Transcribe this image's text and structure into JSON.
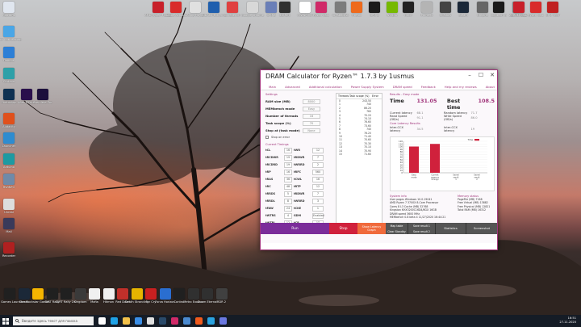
{
  "desktop": {
    "top_icons": [
      {
        "label": "AMD Ryzen Master",
        "color": "#c8202a"
      },
      {
        "label": "Adobe Acrobat",
        "color": "#d92b2b"
      },
      {
        "label": "Aimp Player",
        "color": "#e0e0e0"
      },
      {
        "label": "AIDA64 Extreme",
        "color": "#1f5fae"
      },
      {
        "label": "Cinebench",
        "color": "#e04040"
      },
      {
        "label": "Google Chrome",
        "color": "#d8d8d8"
      },
      {
        "label": "CPU-Z",
        "color": "#6a7fb8"
      },
      {
        "label": "3DMark",
        "color": "#303030"
      },
      {
        "label": "HWiNFO64",
        "color": "#ffffff"
      },
      {
        "label": "Ryzen Calc",
        "color": "#d02a68"
      },
      {
        "label": "CrystalDisk",
        "color": "#7c7c7c"
      },
      {
        "label": "Firefox",
        "color": "#ee6a1c"
      },
      {
        "label": "GPU-Z",
        "color": "#1a1a1a"
      },
      {
        "label": "NVIDIA",
        "color": "#76b900"
      },
      {
        "label": "OCCT",
        "color": "#222222"
      },
      {
        "label": "Prime95",
        "color": "#b4b4b4"
      },
      {
        "label": "Shadow",
        "color": "#444444"
      },
      {
        "label": "Steam",
        "color": "#1b2838"
      },
      {
        "label": "Unigine",
        "color": "#666666"
      },
      {
        "label": "Logitech G",
        "color": "#1a1a1a"
      },
      {
        "label": "Zen Timings",
        "color": "#909090"
      }
    ],
    "right_icons": [
      {
        "label": "DRAM Calc",
        "color": "#c8202a"
      },
      {
        "label": "Ryzen Calc",
        "color": "#d92b2b"
      },
      {
        "label": "CPU TEST",
        "color": "#c02020"
      }
    ],
    "left_icons": [
      {
        "label": "Корзина",
        "color": "#e0e6ef"
      },
      {
        "label": "Этот компьютер",
        "color": "#4aa6e6"
      },
      {
        "label": "Панель",
        "color": "#2d7fd6"
      },
      {
        "label": "Cortana",
        "color": "#2ea0a8"
      },
      {
        "label": "Photoshop",
        "color": "#0f3152"
      },
      {
        "label": "After Effects",
        "color": "#2a0f4c"
      },
      {
        "label": "Premiere Pro",
        "color": "#1c0f3c"
      },
      {
        "label": "Audacity",
        "color": "#e0501c"
      },
      {
        "label": "Launcher",
        "color": "#2e8cd0"
      },
      {
        "label": "Arduino",
        "color": "#1d9aa2"
      },
      {
        "label": "HWiNFO",
        "color": "#6f8aa8"
      },
      {
        "label": "Unreal",
        "color": "#dddddd"
      },
      {
        "label": "Mail",
        "color": "#3a3a5a"
      },
      {
        "label": "Recorder",
        "color": "#b02020"
      }
    ],
    "bottom_icons": [
      {
        "label": "Epic Games Launcher",
        "color": "#202020"
      },
      {
        "label": "Steam",
        "color": "#1b2838"
      },
      {
        "label": "Rockstar Games",
        "color": "#f5b400"
      },
      {
        "label": "DiRT Rally",
        "color": "#202020"
      },
      {
        "label": "DiRT Rally 2.0",
        "color": "#202020"
      },
      {
        "label": "Kingdom",
        "color": "#3a3a3a"
      },
      {
        "label": "Mafia",
        "color": "#f0f0f0"
      },
      {
        "label": "Hitman",
        "color": "#f0f0f0"
      },
      {
        "label": "Red Dead",
        "color": "#c0302a"
      },
      {
        "label": "Death Stranding",
        "color": "#e6b400"
      },
      {
        "label": "Far Cry",
        "color": "#c82020"
      },
      {
        "label": "Forza Horizon",
        "color": "#2a6ed0"
      },
      {
        "label": "Control",
        "color": "#202020"
      },
      {
        "label": "Metro Exodus",
        "color": "#303030"
      },
      {
        "label": "Doom Eternal",
        "color": "#303030"
      },
      {
        "label": "RDR 2",
        "color": "#404040"
      }
    ]
  },
  "app": {
    "title": "DRAM Calculator for Ryzen™ 1.7.3 by 1usmus",
    "menu": [
      "Main",
      "Advanced",
      "Additional calculation",
      "Power Supply System",
      "DRAM speed",
      "Feedback",
      "Help and my reviews",
      "About"
    ],
    "settings": {
      "section": "Settings",
      "rows": [
        {
          "label": "RAM size (MB)",
          "value": "8000"
        },
        {
          "label": "MEMbench mode",
          "value": "Easy"
        },
        {
          "label": "Number of threads",
          "value": "16"
        },
        {
          "label": "Task scope (%)",
          "value": "70"
        },
        {
          "label": "Stop at (task mode)",
          "value": "None"
        }
      ],
      "checkbox": "Stop on error",
      "timings_title": "Current Timings",
      "timings": [
        [
          "tCL",
          "16",
          "tWR",
          "12"
        ],
        [
          "tRCDWR",
          "19",
          "tRDWR",
          "7"
        ],
        [
          "tRCDRD",
          "19",
          "tWRRD",
          "2"
        ],
        [
          "tRP",
          "16",
          "tRFC",
          "560"
        ],
        [
          "tRAS",
          "36",
          "tCWL",
          "16"
        ],
        [
          "tRC",
          "48",
          "tRTP",
          "12"
        ],
        [
          "tRRDS",
          "5",
          "tRDWR",
          "7"
        ],
        [
          "tRRDL",
          "8",
          "tWRRD",
          "3"
        ],
        [
          "tFAW",
          "24",
          "tCKE",
          "1"
        ],
        [
          "tWTRS",
          "4",
          "GDM",
          "Enabled"
        ],
        [
          "tWTRL",
          "12",
          "tCR",
          "1T"
        ]
      ]
    },
    "threads": {
      "headers": [
        "Threads",
        "Task scope (%)",
        "Error"
      ],
      "rows": [
        [
          "0",
          "243.5",
          "0"
        ],
        [
          "1",
          "74",
          "0"
        ],
        [
          "2",
          "86.2",
          "0"
        ],
        [
          "3",
          "76",
          "0"
        ],
        [
          "4",
          "70.2",
          "0"
        ],
        [
          "5",
          "74.1",
          "0"
        ],
        [
          "6",
          "76.6",
          "0"
        ],
        [
          "7",
          "73.6",
          "0"
        ],
        [
          "8",
          "74",
          "0"
        ],
        [
          "9",
          "76.2",
          "0"
        ],
        [
          "10",
          "71.4",
          "0"
        ],
        [
          "11",
          "70.6",
          "0"
        ],
        [
          "12",
          "70.3",
          "0"
        ],
        [
          "13",
          "70.1",
          "0"
        ],
        [
          "14",
          "70.9",
          "0"
        ],
        [
          "15",
          "71.6",
          "0"
        ]
      ]
    },
    "results": {
      "section": "Results - Easy mode",
      "time_label": "Time",
      "time_value": "131.05",
      "best_label": "Best time",
      "best_value": "108.5",
      "latency_label": "Current latency",
      "latency_value": "68.1",
      "rand_lat_label": "Random latency",
      "rand_lat_value": "71.7",
      "read_label": "Read Speed (GB/s)",
      "read_value": "91.1",
      "write_label": "Write Speed (GB/s)",
      "write_value": "86.0",
      "ccx_title": "Core Latency Results",
      "ccx_inter_label": "Inter-CCX latency",
      "ccx_inter_value": "34.5",
      "ccx_intra_label": "Inter-CCX latency",
      "ccx_intra_value": "19",
      "legend": "Time"
    },
    "chart_data": {
      "type": "bar",
      "categories": [
        "Easy mode",
        "Current memory timings",
        "Saved result 1",
        "Saved result 2"
      ],
      "values": [
        100,
        110,
        0,
        0
      ],
      "ylim": [
        0,
        120
      ],
      "yticks": [
        0,
        10,
        20,
        30,
        40,
        50,
        60,
        70,
        80,
        90,
        100,
        110,
        120
      ],
      "series_color": "#d0213c"
    },
    "system": {
      "title": "System info",
      "lines": [
        "User pages                Windows 10.0.19041",
        "AMD Ryzen 7 3700X 8-Core Processor",
        "Cores 8      L3 Cache (MB)      32768",
        "Kingston KHX3200C16D4/8GX      16GB",
        "DRAM speed 3600 MHz",
        "MEMbench 0.8 beta 4      11/27/2020 16:44:21"
      ]
    },
    "memory": {
      "title": "Memory status",
      "lines": [
        "PageFile (MB)          7168",
        "Free Virtual (MB)      13882",
        "Free Physical (MB)     12821",
        "Total RAM (MB)         16312"
      ]
    },
    "buttons": {
      "run": "Run",
      "stop": "Stop",
      "graph": "Show Latency Graph",
      "map_table": "Map table",
      "clear_standby": "Clear Standby",
      "save1": "Save result 1",
      "save2": "Save result 2",
      "statistics": "Statistics",
      "screenshot": "Screenshot"
    }
  },
  "taskbar": {
    "search_placeholder": "Введите здесь текст для поиска",
    "time": "16:51",
    "date": "27.11.2020",
    "apps": [
      {
        "name": "task-view",
        "color": "#ffffff"
      },
      {
        "name": "edge",
        "color": "#1fa2e6"
      },
      {
        "name": "explorer",
        "color": "#f2c14a"
      },
      {
        "name": "store",
        "color": "#3a8ee6"
      },
      {
        "name": "chrome",
        "color": "#e0e0e0"
      },
      {
        "name": "steam",
        "color": "#2a4a6a"
      },
      {
        "name": "ryzen-calc",
        "color": "#d02a68"
      },
      {
        "name": "hwinfo",
        "color": "#4a8ad0"
      },
      {
        "name": "aida",
        "color": "#f05a1c"
      },
      {
        "name": "telegram",
        "color": "#2aa3e0"
      },
      {
        "name": "discord",
        "color": "#6a78e0"
      }
    ]
  }
}
